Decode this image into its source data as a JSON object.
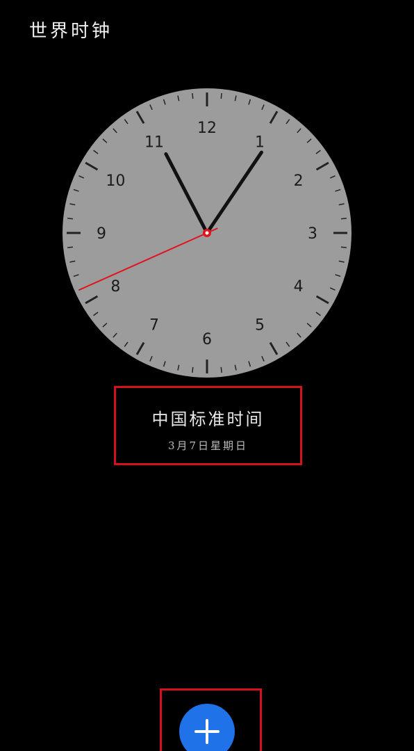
{
  "header": {
    "title": "世界时钟"
  },
  "clock": {
    "numerals": [
      "12",
      "1",
      "2",
      "3",
      "4",
      "5",
      "6",
      "7",
      "8",
      "9",
      "10",
      "11"
    ],
    "time": {
      "hour": 11,
      "minute": 5,
      "second": 41
    },
    "colors": {
      "face": "#9c9c9c",
      "hands": "#111111",
      "second_hand": "#e0141e",
      "ticks": "#222222"
    }
  },
  "timezone": {
    "name": "中国标准时间",
    "date": "3月7日星期日"
  },
  "actions": {
    "add_icon": "plus-icon",
    "accent": "#1f72e8",
    "highlight": "#d4101a"
  }
}
